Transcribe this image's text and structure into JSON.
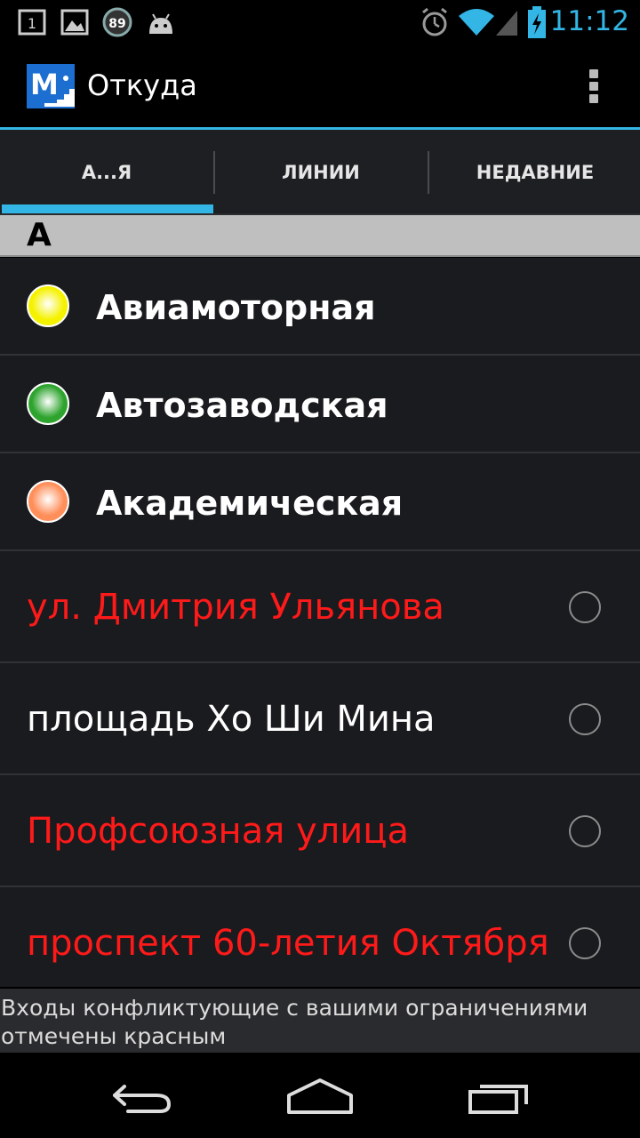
{
  "status_bar": {
    "notification_badge": "1",
    "battery_saver_level": "89",
    "time": "11:12",
    "icons": [
      "notification-count-icon",
      "gallery-icon",
      "badge-89-icon",
      "android-icon",
      "alarm-icon",
      "wifi-icon",
      "signal-icon",
      "battery-charging-icon"
    ]
  },
  "action_bar": {
    "logo_letter": "M",
    "title": "Откуда",
    "overflow_icon": "overflow-menu-icon"
  },
  "tabs": [
    {
      "label": "А...Я",
      "selected": true
    },
    {
      "label": "ЛИНИИ",
      "selected": false
    },
    {
      "label": "НЕДАВНИЕ",
      "selected": false
    }
  ],
  "section": {
    "letter": "А"
  },
  "stations": [
    {
      "name": "Авиамоторная",
      "line_color": "#f5f200"
    },
    {
      "name": "Автозаводская",
      "line_color": "#2ea42e"
    },
    {
      "name": "Академическая",
      "line_color": "#ff8f5a"
    }
  ],
  "entrances": [
    {
      "name": "ул. Дмитрия Ульянова",
      "conflict": true,
      "color": "#ff1a1a"
    },
    {
      "name": "площадь Хо Ши Мина",
      "conflict": false,
      "color": "#ffffff"
    },
    {
      "name": "Профсоюзная улица",
      "conflict": true,
      "color": "#ff1a1a"
    },
    {
      "name": "проспект 60-летия Октября",
      "conflict": true,
      "color": "#ff1a1a"
    }
  ],
  "footer_note": {
    "line1": "Входы конфликтующие с вашими ограничениями",
    "line2": "отмечены красным"
  },
  "colors": {
    "accent": "#33b5e5",
    "list_bg": "#1a1b1e",
    "conflict": "#ff1a1a"
  },
  "nav_bar": {
    "buttons": [
      "back-icon",
      "home-icon",
      "recents-icon"
    ]
  }
}
